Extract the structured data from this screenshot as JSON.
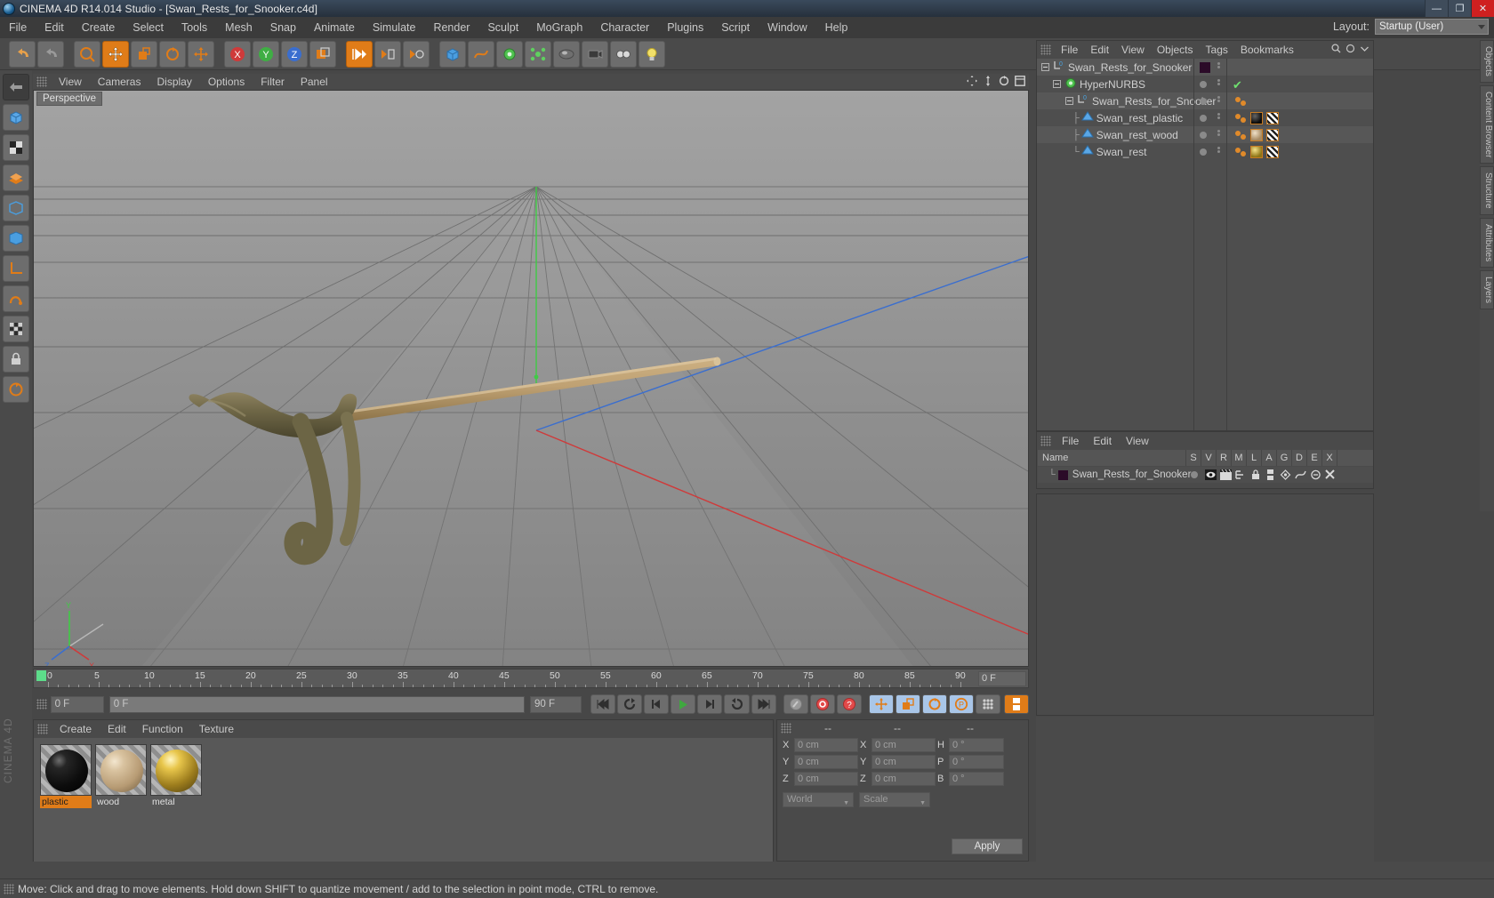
{
  "titlebar": {
    "title": "CINEMA 4D R14.014 Studio - [Swan_Rests_for_Snooker.c4d]",
    "minimize": "—",
    "maximize": "❐",
    "close": "✕",
    "app_icon": "cinema4d-logo-icon"
  },
  "menubar": {
    "items": [
      "File",
      "Edit",
      "Create",
      "Select",
      "Tools",
      "Mesh",
      "Snap",
      "Animate",
      "Simulate",
      "Render",
      "Sculpt",
      "MoGraph",
      "Character",
      "Plugins",
      "Script",
      "Window",
      "Help"
    ],
    "layout_label": "Layout:",
    "layout_value": "Startup (User)"
  },
  "viewport": {
    "menu": [
      "View",
      "Cameras",
      "Display",
      "Options",
      "Filter",
      "Panel"
    ],
    "label": "Perspective",
    "axis_labels": {
      "y": "Y",
      "x": "X",
      "z": "Z"
    }
  },
  "timeline": {
    "ticks": [
      "0",
      "5",
      "10",
      "15",
      "20",
      "25",
      "30",
      "35",
      "40",
      "45",
      "50",
      "55",
      "60",
      "65",
      "70",
      "75",
      "80",
      "85",
      "90"
    ],
    "current_frame_field": "0 F",
    "start_field": "0 F",
    "end_field": "90 F",
    "range_field": "90 F"
  },
  "material_manager": {
    "menu": [
      "Create",
      "Edit",
      "Function",
      "Texture"
    ],
    "materials": [
      {
        "name": "plastic",
        "color": "#0d0d0d",
        "selected": true
      },
      {
        "name": "wood",
        "color": "#c4a77e",
        "selected": false
      },
      {
        "name": "metal",
        "color": "#d6ae3a",
        "selected": false
      }
    ]
  },
  "coordinates": {
    "headers": [
      "--",
      "--",
      "--"
    ],
    "rows": [
      {
        "t1": "X",
        "v1": "0 cm",
        "t2": "X",
        "v2": "0 cm",
        "t3": "H",
        "v3": "0 °"
      },
      {
        "t1": "Y",
        "v1": "0 cm",
        "t2": "Y",
        "v2": "0 cm",
        "t3": "P",
        "v3": "0 °"
      },
      {
        "t1": "Z",
        "v1": "0 cm",
        "t2": "Z",
        "v2": "0 cm",
        "t3": "B",
        "v3": "0 °"
      }
    ],
    "space_select": "World",
    "mode_select": "Scale",
    "apply_label": "Apply"
  },
  "object_manager": {
    "menu": [
      "File",
      "Edit",
      "View",
      "Objects",
      "Tags",
      "Bookmarks"
    ],
    "rows": [
      {
        "name": "Swan_Rests_for_Snooker",
        "indent": 0,
        "icon": "null-object-icon",
        "swatch": "#2b0b28",
        "tags": []
      },
      {
        "name": "HyperNURBS",
        "indent": 1,
        "icon": "hypernurbs-icon",
        "swatch": "",
        "check": true,
        "tags": []
      },
      {
        "name": "Swan_Rests_for_Snooker",
        "indent": 2,
        "icon": "null-object-icon",
        "swatch": "",
        "tags": [
          "selection"
        ]
      },
      {
        "name": "Swan_rest_plastic",
        "indent": 3,
        "icon": "polygon-object-icon",
        "swatch": "",
        "tags": [
          "selection",
          "material-black",
          "uv"
        ]
      },
      {
        "name": "Swan_rest_wood",
        "indent": 3,
        "icon": "polygon-object-icon",
        "swatch": "",
        "tags": [
          "selection",
          "material-wood",
          "uv"
        ]
      },
      {
        "name": "Swan_rest",
        "indent": 3,
        "icon": "polygon-object-icon",
        "swatch": "",
        "tags": [
          "selection",
          "material-metal",
          "uv"
        ]
      }
    ]
  },
  "layer_manager": {
    "menu": [
      "File",
      "Edit",
      "View"
    ],
    "columns": [
      "Name",
      "S",
      "V",
      "R",
      "M",
      "L",
      "A",
      "G",
      "D",
      "E",
      "X"
    ],
    "rows": [
      {
        "name": "Swan_Rests_for_Snooker",
        "color": "#2b0b28"
      }
    ]
  },
  "right_tabs": [
    "Objects",
    "Content Browser",
    "Structure",
    "Attributes",
    "Layers"
  ],
  "statusbar": {
    "message": "Move: Click and drag to move elements. Hold down SHIFT to quantize movement / add to the selection in point mode, CTRL to remove."
  },
  "branding": {
    "vertical_text": "CINEMA 4D"
  },
  "colors": {
    "accent_orange": "#e07c18",
    "panel_bg": "#4a4a4a",
    "viewport_bg": "#8c8c8c",
    "title_blue": "#2e3b4a",
    "axis_x": "#cf3a3a",
    "axis_y": "#44c44a",
    "axis_z": "#3a6ecf"
  }
}
